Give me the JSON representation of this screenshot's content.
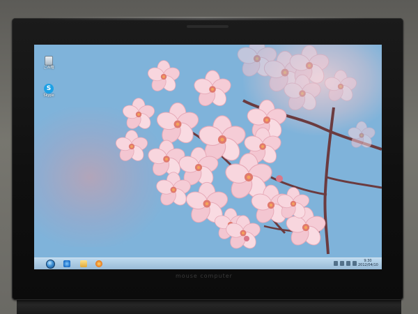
{
  "desktop": {
    "icons": [
      {
        "label": "ごみ箱",
        "icon": "recycle-bin-icon"
      },
      {
        "label": "Skype",
        "icon": "skype-icon"
      }
    ],
    "wallpaper": "cherry blossom branch",
    "colors": {
      "sky": "#7fb3da",
      "petal": "#f4c8d3",
      "petal_center": "#e07a6e",
      "branch": "#6b3b3f"
    }
  },
  "taskbar": {
    "start": "start-orb-icon",
    "pinned": [
      "internet-explorer-icon",
      "folder-icon",
      "media-player-icon"
    ],
    "clock": {
      "time": "9:30",
      "date": "2012/04/10"
    }
  },
  "bezel": {
    "brand": "mouse computer"
  }
}
